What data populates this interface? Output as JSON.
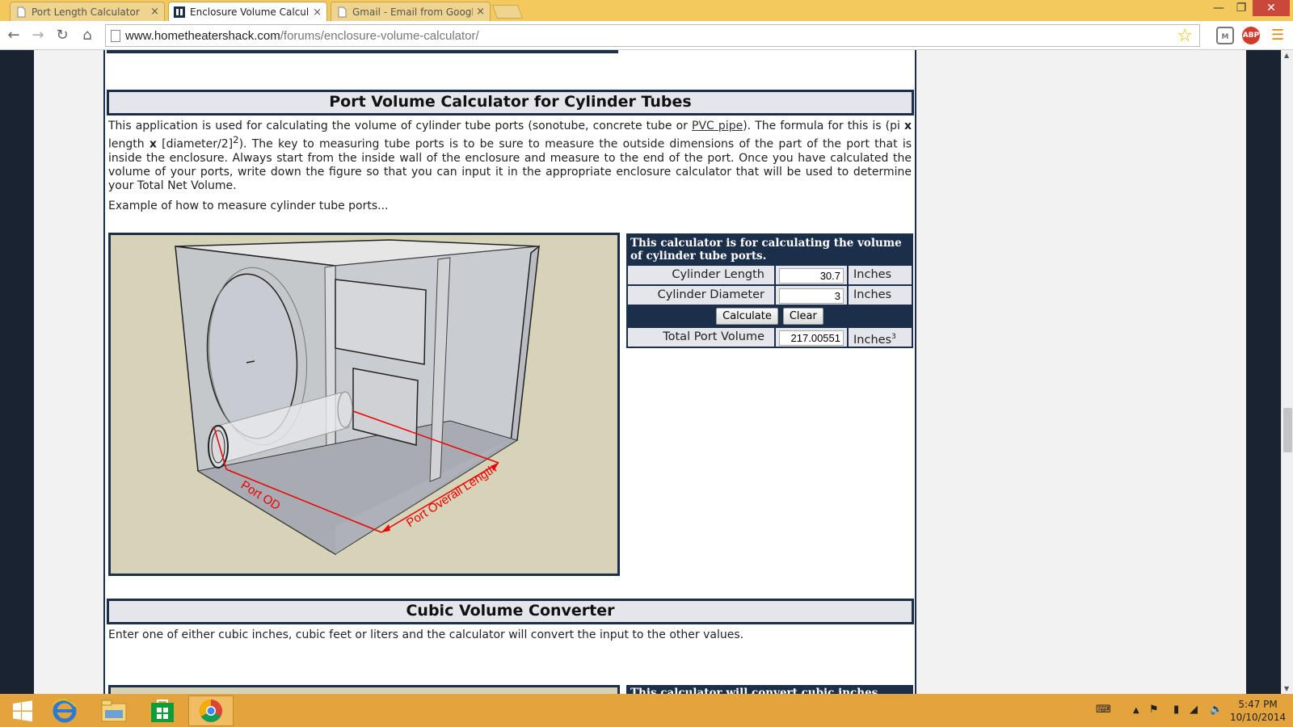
{
  "browser": {
    "tabs": [
      {
        "title": "Port Length Calculator",
        "active": false
      },
      {
        "title": "Enclosure Volume Calcula",
        "active": true
      },
      {
        "title": "Gmail - Email from Googl",
        "active": false
      }
    ],
    "close_glyph": "×",
    "url_domain": "www.hometheatershack.com",
    "url_path": "/forums/enclosure-volume-calculator/"
  },
  "page": {
    "port_section": {
      "title": "Port Volume Calculator for Cylinder Tubes",
      "intro_before_link": "This application is used for calculating the volume of cylinder tube ports (sonotube, concrete tube or ",
      "link_text": "PVC pipe",
      "intro_after_link": "). The formula for this is (pi ",
      "times": "x",
      "formula_length": " length ",
      "formula_diameter": " [diameter/2]",
      "formula_exp": "2",
      "intro_rest": "). The key to measuring tube ports is to be sure to measure the outside dimensions of the part of the port that is inside the enclosure. Always start from the inside wall of the enclosure and measure to the end of the port. Once you have calculated the volume of your ports, write down the figure so that you can input it in the appropriate enclosure calculator that will be used to determine your Total Net Volume.",
      "example_text": "Example of how to measure cylinder tube ports...",
      "diagram_labels": {
        "port_od": "Port OD",
        "port_length": "Port Overall Length"
      }
    },
    "calculator": {
      "title": "This calculator is for calculating the volume of cylinder tube ports.",
      "rows": [
        {
          "label": "Cylinder Length",
          "value": "30.7",
          "unit": "Inches"
        },
        {
          "label": "Cylinder Diameter",
          "value": "3",
          "unit": "Inches"
        }
      ],
      "calculate_label": "Calculate",
      "clear_label": "Clear",
      "result": {
        "label": "Total Port Volume",
        "value": "217.00551",
        "unit": "Inches",
        "unit_exp": "3"
      }
    },
    "cubic_section": {
      "title": "Cubic Volume Converter",
      "description": "Enter one of either cubic inches, cubic feet or liters and the calculator will convert the input to the other values.",
      "calc_title_partial": "This calculator will convert cubic inches"
    }
  },
  "taskbar": {
    "time": "5:47 PM",
    "date": "10/10/2014"
  },
  "colors": {
    "navy": "#1b2f4b",
    "title_bar": "#f3c85c",
    "taskbar": "#e3a43e",
    "cell_bg": "#e4e6ec"
  }
}
